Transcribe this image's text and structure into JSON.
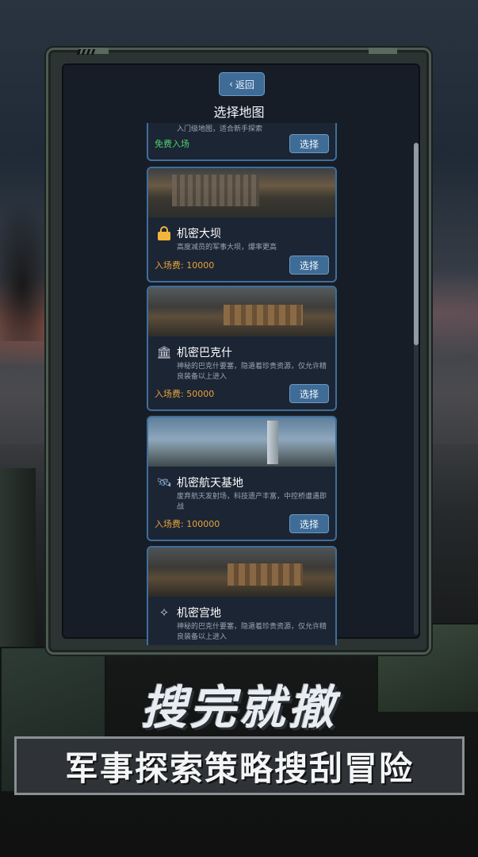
{
  "header": {
    "back_label": "返回",
    "back_icon": "chevron-left-icon",
    "title": "选择地图"
  },
  "maps": [
    {
      "name": "",
      "desc": "入门级地图，适合新手探索",
      "fee": "免费入场",
      "fee_color": "#4fd070",
      "button": "选择",
      "icon": "warning-icon"
    },
    {
      "name": "机密大坝",
      "desc": "高度减员的军事大坝，爆率更高",
      "fee": "入场费: 10000",
      "button": "选择",
      "icon": "lock-icon"
    },
    {
      "name": "机密巴克什",
      "desc": "神秘的巴克什要塞，隐遁着珍贵资源，仅允许精良装备以上进入",
      "fee": "入场费: 50000",
      "button": "选择",
      "icon": "temple-icon"
    },
    {
      "name": "机密航天基地",
      "desc": "废弃航天发射场，科技遗产丰富，中控桥遭遇即战",
      "fee": "入场费: 100000",
      "button": "选择",
      "icon": "satellite-icon"
    },
    {
      "name": "机密宫地",
      "desc": "神秘的巴克什要塞，隐遁着珍贵资源，仅允许精良装备以上进入",
      "icon": "compass-icon"
    }
  ],
  "promo": {
    "headline": "搜完就撤",
    "subline": "军事探索策略搜刮冒险"
  },
  "colors": {
    "accent": "#3f6c96",
    "fee": "#e7a43a",
    "free": "#4fd070"
  }
}
